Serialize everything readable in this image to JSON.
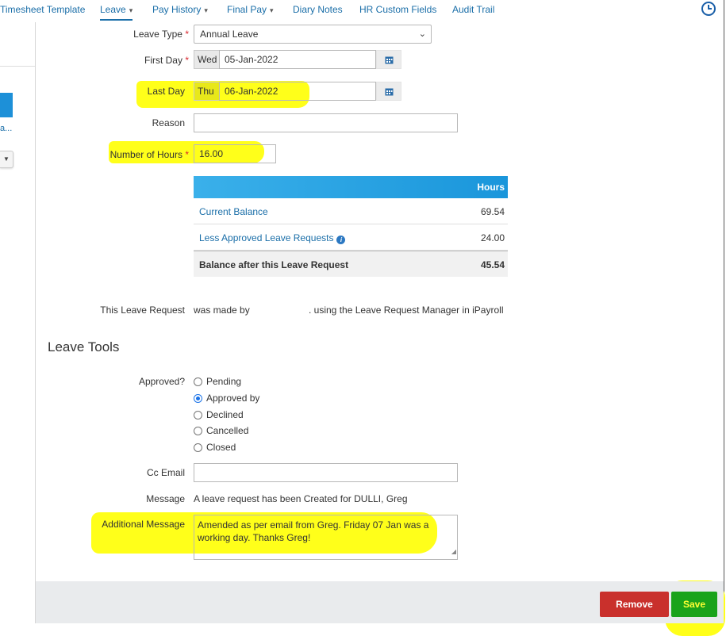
{
  "topnav": {
    "tabs": [
      {
        "label": "Timesheet Template"
      },
      {
        "label": "Leave",
        "caret": "▾",
        "active": true
      },
      {
        "label": "Pay History",
        "caret": "▾"
      },
      {
        "label": "Final Pay",
        "caret": "▾"
      },
      {
        "label": "Diary Notes"
      },
      {
        "label": "HR Custom Fields"
      },
      {
        "label": "Audit Trail"
      }
    ],
    "history_icon": "clock-icon"
  },
  "sidebar": {
    "truncated_text": "a...",
    "toggle_icon": "chevron-down-icon"
  },
  "form": {
    "leave_type": {
      "label": "Leave Type",
      "required": "*",
      "value": "Annual Leave"
    },
    "first_day": {
      "label": "First Day",
      "required": "*",
      "weekday": "Wed",
      "value": "05-Jan-2022"
    },
    "last_day": {
      "label": "Last Day",
      "weekday": "Thu",
      "value": "06-Jan-2022"
    },
    "reason": {
      "label": "Reason",
      "value": ""
    },
    "hours": {
      "label": "Number of Hours",
      "required": "*",
      "value": "16.00"
    }
  },
  "balance_table": {
    "header": "Hours",
    "rows": [
      {
        "label": "Current Balance",
        "value": "69.54"
      },
      {
        "label": "Less Approved Leave Requests",
        "value": "24.00"
      }
    ],
    "total": {
      "label": "Balance after this Leave Request",
      "value": "45.54"
    }
  },
  "request_info": {
    "label": "This Leave Request",
    "text_before": "was made by",
    "text_after": ". using the Leave Request Manager in iPayroll"
  },
  "leave_tools": {
    "title": "Leave Tools",
    "approved_label": "Approved?",
    "options": [
      "Pending",
      "Approved by",
      "Declined",
      "Cancelled",
      "Closed"
    ],
    "selected": "Approved by",
    "cc_email": {
      "label": "Cc Email",
      "value": ""
    },
    "message": {
      "label": "Message",
      "value": "A leave request has been Created for DULLI, Greg"
    },
    "additional_message": {
      "label": "Additional Message",
      "value": "Amended as per email from Greg. Friday 07 Jan was a working day. Thanks Greg!"
    }
  },
  "footer": {
    "remove_label": "Remove",
    "save_label": "Save"
  },
  "colors": {
    "link": "#1a6ea8",
    "highlight": "#ffff1a",
    "remove": "#c9302c",
    "save": "#1aa31a",
    "table_header": "#1a96db"
  }
}
